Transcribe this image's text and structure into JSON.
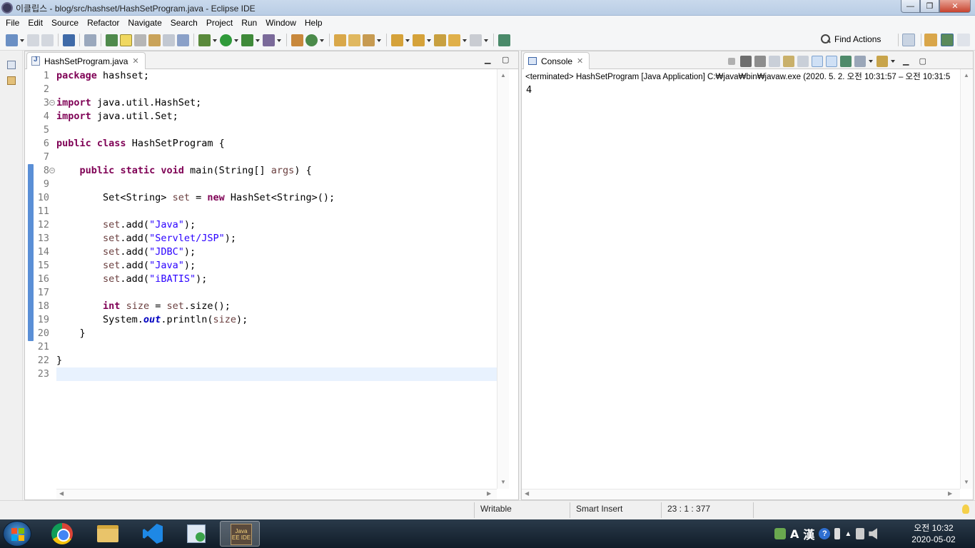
{
  "window": {
    "title": "이클립스 - blog/src/hashset/HashSetProgram.java - Eclipse IDE",
    "controls": {
      "minimize": "—",
      "maximize": "❐",
      "close": "✕"
    }
  },
  "menubar": [
    "File",
    "Edit",
    "Source",
    "Refactor",
    "Navigate",
    "Search",
    "Project",
    "Run",
    "Window",
    "Help"
  ],
  "toolbar": {
    "find_actions": "Find Actions"
  },
  "editor": {
    "tab_label": "HashSetProgram.java",
    "tab_close": "✕",
    "lines": [
      {
        "n": "1",
        "code": [
          {
            "t": "package",
            "c": "kw"
          },
          {
            "t": " hashset;"
          }
        ]
      },
      {
        "n": "2",
        "code": []
      },
      {
        "n": "3",
        "code": [
          {
            "t": "import",
            "c": "kw"
          },
          {
            "t": " java.util.HashSet;"
          }
        ],
        "fold": true
      },
      {
        "n": "4",
        "code": [
          {
            "t": "import",
            "c": "kw"
          },
          {
            "t": " java.util.Set;"
          }
        ]
      },
      {
        "n": "5",
        "code": []
      },
      {
        "n": "6",
        "code": [
          {
            "t": "public",
            "c": "kw"
          },
          {
            "t": " "
          },
          {
            "t": "class",
            "c": "kw"
          },
          {
            "t": " HashSetProgram {"
          }
        ]
      },
      {
        "n": "7",
        "code": []
      },
      {
        "n": "8",
        "code": [
          {
            "t": "    "
          },
          {
            "t": "public",
            "c": "kw"
          },
          {
            "t": " "
          },
          {
            "t": "static",
            "c": "kw"
          },
          {
            "t": " "
          },
          {
            "t": "void",
            "c": "kw"
          },
          {
            "t": " main(String[] "
          },
          {
            "t": "args",
            "c": "var"
          },
          {
            "t": ") {"
          }
        ],
        "fold": true
      },
      {
        "n": "9",
        "code": []
      },
      {
        "n": "10",
        "code": [
          {
            "t": "        Set<String> "
          },
          {
            "t": "set",
            "c": "var"
          },
          {
            "t": " = "
          },
          {
            "t": "new",
            "c": "kw"
          },
          {
            "t": " HashSet<String>();"
          }
        ]
      },
      {
        "n": "11",
        "code": []
      },
      {
        "n": "12",
        "code": [
          {
            "t": "        "
          },
          {
            "t": "set",
            "c": "var"
          },
          {
            "t": ".add("
          },
          {
            "t": "\"Java\"",
            "c": "str"
          },
          {
            "t": ");"
          }
        ]
      },
      {
        "n": "13",
        "code": [
          {
            "t": "        "
          },
          {
            "t": "set",
            "c": "var"
          },
          {
            "t": ".add("
          },
          {
            "t": "\"Servlet/JSP\"",
            "c": "str"
          },
          {
            "t": ");"
          }
        ]
      },
      {
        "n": "14",
        "code": [
          {
            "t": "        "
          },
          {
            "t": "set",
            "c": "var"
          },
          {
            "t": ".add("
          },
          {
            "t": "\"JDBC\"",
            "c": "str"
          },
          {
            "t": ");"
          }
        ]
      },
      {
        "n": "15",
        "code": [
          {
            "t": "        "
          },
          {
            "t": "set",
            "c": "var"
          },
          {
            "t": ".add("
          },
          {
            "t": "\"Java\"",
            "c": "str"
          },
          {
            "t": ");"
          }
        ]
      },
      {
        "n": "16",
        "code": [
          {
            "t": "        "
          },
          {
            "t": "set",
            "c": "var"
          },
          {
            "t": ".add("
          },
          {
            "t": "\"iBATIS\"",
            "c": "str"
          },
          {
            "t": ");"
          }
        ]
      },
      {
        "n": "17",
        "code": []
      },
      {
        "n": "18",
        "code": [
          {
            "t": "        "
          },
          {
            "t": "int",
            "c": "kw"
          },
          {
            "t": " "
          },
          {
            "t": "size",
            "c": "var"
          },
          {
            "t": " = "
          },
          {
            "t": "set",
            "c": "var"
          },
          {
            "t": ".size();"
          }
        ]
      },
      {
        "n": "19",
        "code": [
          {
            "t": "        System."
          },
          {
            "t": "out",
            "c": "fld"
          },
          {
            "t": ".println("
          },
          {
            "t": "size",
            "c": "var"
          },
          {
            "t": ");"
          }
        ]
      },
      {
        "n": "20",
        "code": [
          {
            "t": "    }"
          }
        ]
      },
      {
        "n": "21",
        "code": []
      },
      {
        "n": "22",
        "code": [
          {
            "t": "}"
          }
        ]
      },
      {
        "n": "23",
        "code": []
      }
    ]
  },
  "console": {
    "tab_label": "Console",
    "tab_close": "✕",
    "status": "<terminated> HashSetProgram [Java Application] C:₩java₩bin₩javaw.exe  (2020. 5. 2. 오전 10:31:57 – 오전 10:31:5",
    "output": "4"
  },
  "statusbar": {
    "writable": "Writable",
    "insert_mode": "Smart Insert",
    "position": "23 : 1 : 377"
  },
  "taskbar": {
    "tray_lang": "A",
    "tray_ime": "漢",
    "tray_help": "?",
    "clock_time": "오전 10:32",
    "clock_date": "2020-05-02",
    "eclipse_label": "Java EE IDE"
  }
}
